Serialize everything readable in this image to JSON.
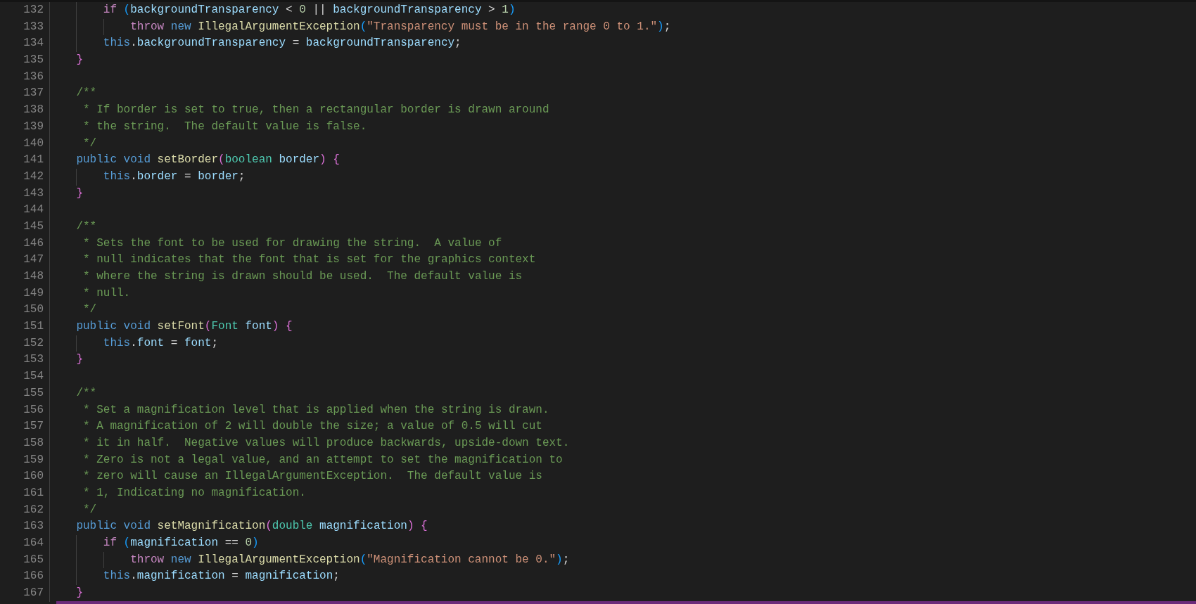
{
  "editor": {
    "lines": [
      {
        "number": "132",
        "tokens": [
          {
            "kind": "control",
            "text": "        if "
          },
          {
            "kind": "bracket3",
            "text": "("
          },
          {
            "kind": "variable",
            "text": "backgroundTransparency"
          },
          {
            "kind": "plain",
            "text": " < "
          },
          {
            "kind": "number",
            "text": "0"
          },
          {
            "kind": "plain",
            "text": " || "
          },
          {
            "kind": "variable",
            "text": "backgroundTransparency"
          },
          {
            "kind": "plain",
            "text": " > "
          },
          {
            "kind": "number",
            "text": "1"
          },
          {
            "kind": "bracket3",
            "text": ")"
          }
        ]
      },
      {
        "number": "133",
        "tokens": [
          {
            "kind": "control",
            "text": "            throw "
          },
          {
            "kind": "keyword",
            "text": "new "
          },
          {
            "kind": "function",
            "text": "IllegalArgumentException"
          },
          {
            "kind": "bracket3",
            "text": "("
          },
          {
            "kind": "string",
            "text": "\"Transparency must be in the range 0 to 1.\""
          },
          {
            "kind": "bracket3",
            "text": ")"
          },
          {
            "kind": "plain",
            "text": ";"
          }
        ]
      },
      {
        "number": "134",
        "tokens": [
          {
            "kind": "keyword",
            "text": "        this"
          },
          {
            "kind": "plain",
            "text": "."
          },
          {
            "kind": "variable",
            "text": "backgroundTransparency"
          },
          {
            "kind": "plain",
            "text": " = "
          },
          {
            "kind": "variable",
            "text": "backgroundTransparency"
          },
          {
            "kind": "plain",
            "text": ";"
          }
        ]
      },
      {
        "number": "135",
        "tokens": [
          {
            "kind": "bracket2",
            "text": "    }"
          }
        ]
      },
      {
        "number": "136"
      },
      {
        "number": "137",
        "tokens": [
          {
            "kind": "comment",
            "text": "    /**"
          }
        ]
      },
      {
        "number": "138",
        "tokens": [
          {
            "kind": "comment",
            "text": "     * If border is set to true, then a rectangular border is drawn around"
          }
        ]
      },
      {
        "number": "139",
        "tokens": [
          {
            "kind": "comment",
            "text": "     * the string.  The default value is false."
          }
        ]
      },
      {
        "number": "140",
        "tokens": [
          {
            "kind": "comment",
            "text": "     */"
          }
        ]
      },
      {
        "number": "141",
        "tokens": [
          {
            "kind": "keyword",
            "text": "    public void "
          },
          {
            "kind": "function",
            "text": "setBorder"
          },
          {
            "kind": "bracket2",
            "text": "("
          },
          {
            "kind": "type",
            "text": "boolean "
          },
          {
            "kind": "variable",
            "text": "border"
          },
          {
            "kind": "bracket2",
            "text": ") {"
          }
        ]
      },
      {
        "number": "142",
        "tokens": [
          {
            "kind": "keyword",
            "text": "        this"
          },
          {
            "kind": "plain",
            "text": "."
          },
          {
            "kind": "variable",
            "text": "border"
          },
          {
            "kind": "plain",
            "text": " = "
          },
          {
            "kind": "variable",
            "text": "border"
          },
          {
            "kind": "plain",
            "text": ";"
          }
        ]
      },
      {
        "number": "143",
        "tokens": [
          {
            "kind": "bracket2",
            "text": "    }"
          }
        ]
      },
      {
        "number": "144"
      },
      {
        "number": "145",
        "tokens": [
          {
            "kind": "comment",
            "text": "    /**"
          }
        ]
      },
      {
        "number": "146",
        "tokens": [
          {
            "kind": "comment",
            "text": "     * Sets the font to be used for drawing the string.  A value of"
          }
        ]
      },
      {
        "number": "147",
        "tokens": [
          {
            "kind": "comment",
            "text": "     * null indicates that the font that is set for the graphics context"
          }
        ]
      },
      {
        "number": "148",
        "tokens": [
          {
            "kind": "comment",
            "text": "     * where the string is drawn should be used.  The default value is"
          }
        ]
      },
      {
        "number": "149",
        "tokens": [
          {
            "kind": "comment",
            "text": "     * null."
          }
        ]
      },
      {
        "number": "150",
        "tokens": [
          {
            "kind": "comment",
            "text": "     */"
          }
        ]
      },
      {
        "number": "151",
        "tokens": [
          {
            "kind": "keyword",
            "text": "    public void "
          },
          {
            "kind": "function",
            "text": "setFont"
          },
          {
            "kind": "bracket2",
            "text": "("
          },
          {
            "kind": "type",
            "text": "Font "
          },
          {
            "kind": "variable",
            "text": "font"
          },
          {
            "kind": "bracket2",
            "text": ") {"
          }
        ]
      },
      {
        "number": "152",
        "tokens": [
          {
            "kind": "keyword",
            "text": "        this"
          },
          {
            "kind": "plain",
            "text": "."
          },
          {
            "kind": "variable",
            "text": "font"
          },
          {
            "kind": "plain",
            "text": " = "
          },
          {
            "kind": "variable",
            "text": "font"
          },
          {
            "kind": "plain",
            "text": ";"
          }
        ]
      },
      {
        "number": "153",
        "tokens": [
          {
            "kind": "bracket2",
            "text": "    }"
          }
        ]
      },
      {
        "number": "154"
      },
      {
        "number": "155",
        "tokens": [
          {
            "kind": "comment",
            "text": "    /**"
          }
        ]
      },
      {
        "number": "156",
        "tokens": [
          {
            "kind": "comment",
            "text": "     * Set a magnification level that is applied when the string is drawn."
          }
        ]
      },
      {
        "number": "157",
        "tokens": [
          {
            "kind": "comment",
            "text": "     * A magnification of 2 will double the size; a value of 0.5 will cut"
          }
        ]
      },
      {
        "number": "158",
        "tokens": [
          {
            "kind": "comment",
            "text": "     * it in half.  Negative values will produce backwards, upside-down text."
          }
        ]
      },
      {
        "number": "159",
        "tokens": [
          {
            "kind": "comment",
            "text": "     * Zero is not a legal value, and an attempt to set the magnification to"
          }
        ]
      },
      {
        "number": "160",
        "tokens": [
          {
            "kind": "comment",
            "text": "     * zero will cause an IllegalArgumentException.  The default value is"
          }
        ]
      },
      {
        "number": "161",
        "tokens": [
          {
            "kind": "comment",
            "text": "     * 1, Indicating no magnification."
          }
        ]
      },
      {
        "number": "162",
        "tokens": [
          {
            "kind": "comment",
            "text": "     */"
          }
        ]
      },
      {
        "number": "163",
        "tokens": [
          {
            "kind": "keyword",
            "text": "    public void "
          },
          {
            "kind": "function",
            "text": "setMagnification"
          },
          {
            "kind": "bracket2",
            "text": "("
          },
          {
            "kind": "type",
            "text": "double "
          },
          {
            "kind": "variable",
            "text": "magnification"
          },
          {
            "kind": "bracket2",
            "text": ") {"
          }
        ]
      },
      {
        "number": "164",
        "tokens": [
          {
            "kind": "control",
            "text": "        if "
          },
          {
            "kind": "bracket3",
            "text": "("
          },
          {
            "kind": "variable",
            "text": "magnification"
          },
          {
            "kind": "plain",
            "text": " == "
          },
          {
            "kind": "number",
            "text": "0"
          },
          {
            "kind": "bracket3",
            "text": ")"
          }
        ]
      },
      {
        "number": "165",
        "tokens": [
          {
            "kind": "control",
            "text": "            throw "
          },
          {
            "kind": "keyword",
            "text": "new "
          },
          {
            "kind": "function",
            "text": "IllegalArgumentException"
          },
          {
            "kind": "bracket3",
            "text": "("
          },
          {
            "kind": "string",
            "text": "\"Magnification cannot be 0.\""
          },
          {
            "kind": "bracket3",
            "text": ")"
          },
          {
            "kind": "plain",
            "text": ";"
          }
        ]
      },
      {
        "number": "166",
        "tokens": [
          {
            "kind": "keyword",
            "text": "        this"
          },
          {
            "kind": "plain",
            "text": "."
          },
          {
            "kind": "variable",
            "text": "magnification"
          },
          {
            "kind": "plain",
            "text": " = "
          },
          {
            "kind": "variable",
            "text": "magnification"
          },
          {
            "kind": "plain",
            "text": ";"
          }
        ]
      },
      {
        "number": "167",
        "tokens": [
          {
            "kind": "bracket2",
            "text": "    }"
          }
        ]
      }
    ]
  }
}
